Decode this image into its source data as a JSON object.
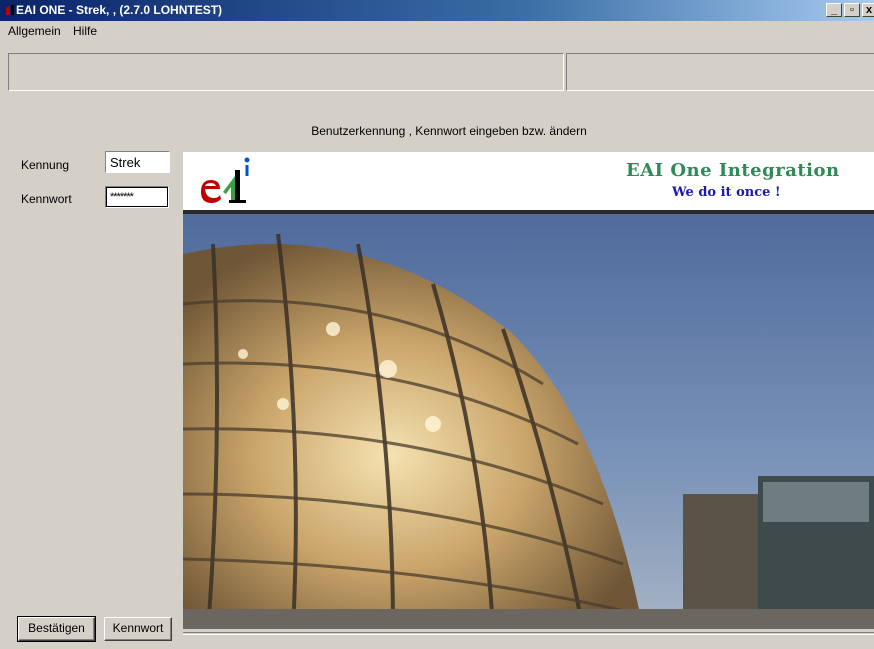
{
  "window": {
    "title": "EAI ONE - Strek, , (2.7.0 LOHNTEST)",
    "minimize_label": "_",
    "maximize_label": "▫",
    "close_label": "x"
  },
  "menu": {
    "items": [
      {
        "label": "Allgemein"
      },
      {
        "label": "Hilfe"
      }
    ]
  },
  "form": {
    "instruction": "Benutzerkennung , Kennwort eingeben bzw. ändern",
    "kennung_label": "Kennung",
    "kennung_value": "Strek",
    "kennwort_label": "Kennwort",
    "kennwort_value": "*******",
    "confirm_button": "Bestätigen",
    "password_button": "Kennwort"
  },
  "banner": {
    "logo_text": "e1i",
    "line1": "EAI One Integration",
    "line2": "We do it once !"
  },
  "colors": {
    "titlebar_start": "#0a246a",
    "titlebar_end": "#a6caf0",
    "background": "#d4d0c8",
    "banner_line1": "#2e8b57",
    "banner_line2": "#1a1ab0"
  }
}
